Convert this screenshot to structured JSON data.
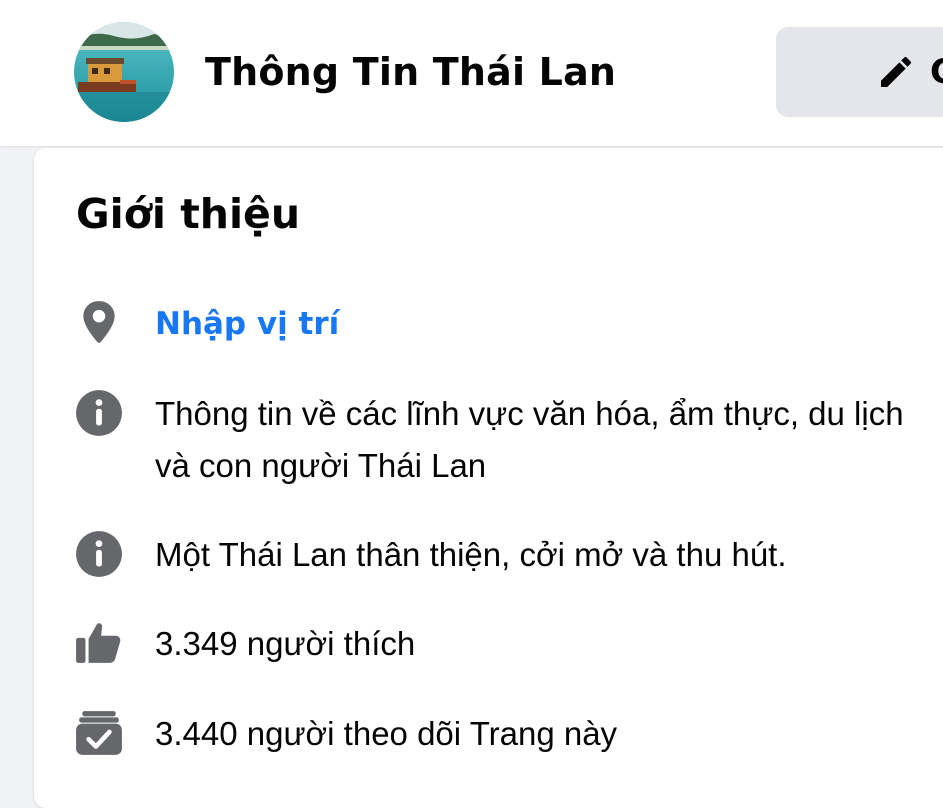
{
  "header": {
    "page_name": "Thông Tin Thái Lan",
    "edit_button_label": "C"
  },
  "intro": {
    "title": "Giới thiệu",
    "rows": [
      {
        "icon": "location-pin-icon",
        "text": "Nhập vị trí"
      },
      {
        "icon": "info-icon",
        "text": "Thông tin về các lĩnh vực văn hóa, ẩm thực, du lịch và con người Thái Lan"
      },
      {
        "icon": "info-icon",
        "text": "Một Thái Lan thân thiện, cởi mở và thu hút."
      },
      {
        "icon": "thumbs-up-icon",
        "text": "3.349 người thích"
      },
      {
        "icon": "follow-check-icon",
        "text": "3.440 người theo dõi Trang này"
      }
    ]
  },
  "colors": {
    "link": "#1877f2",
    "icon_gray": "#65676b",
    "text": "#050505",
    "button_bg": "#e4e6eb",
    "page_bg": "#f0f2f5"
  }
}
